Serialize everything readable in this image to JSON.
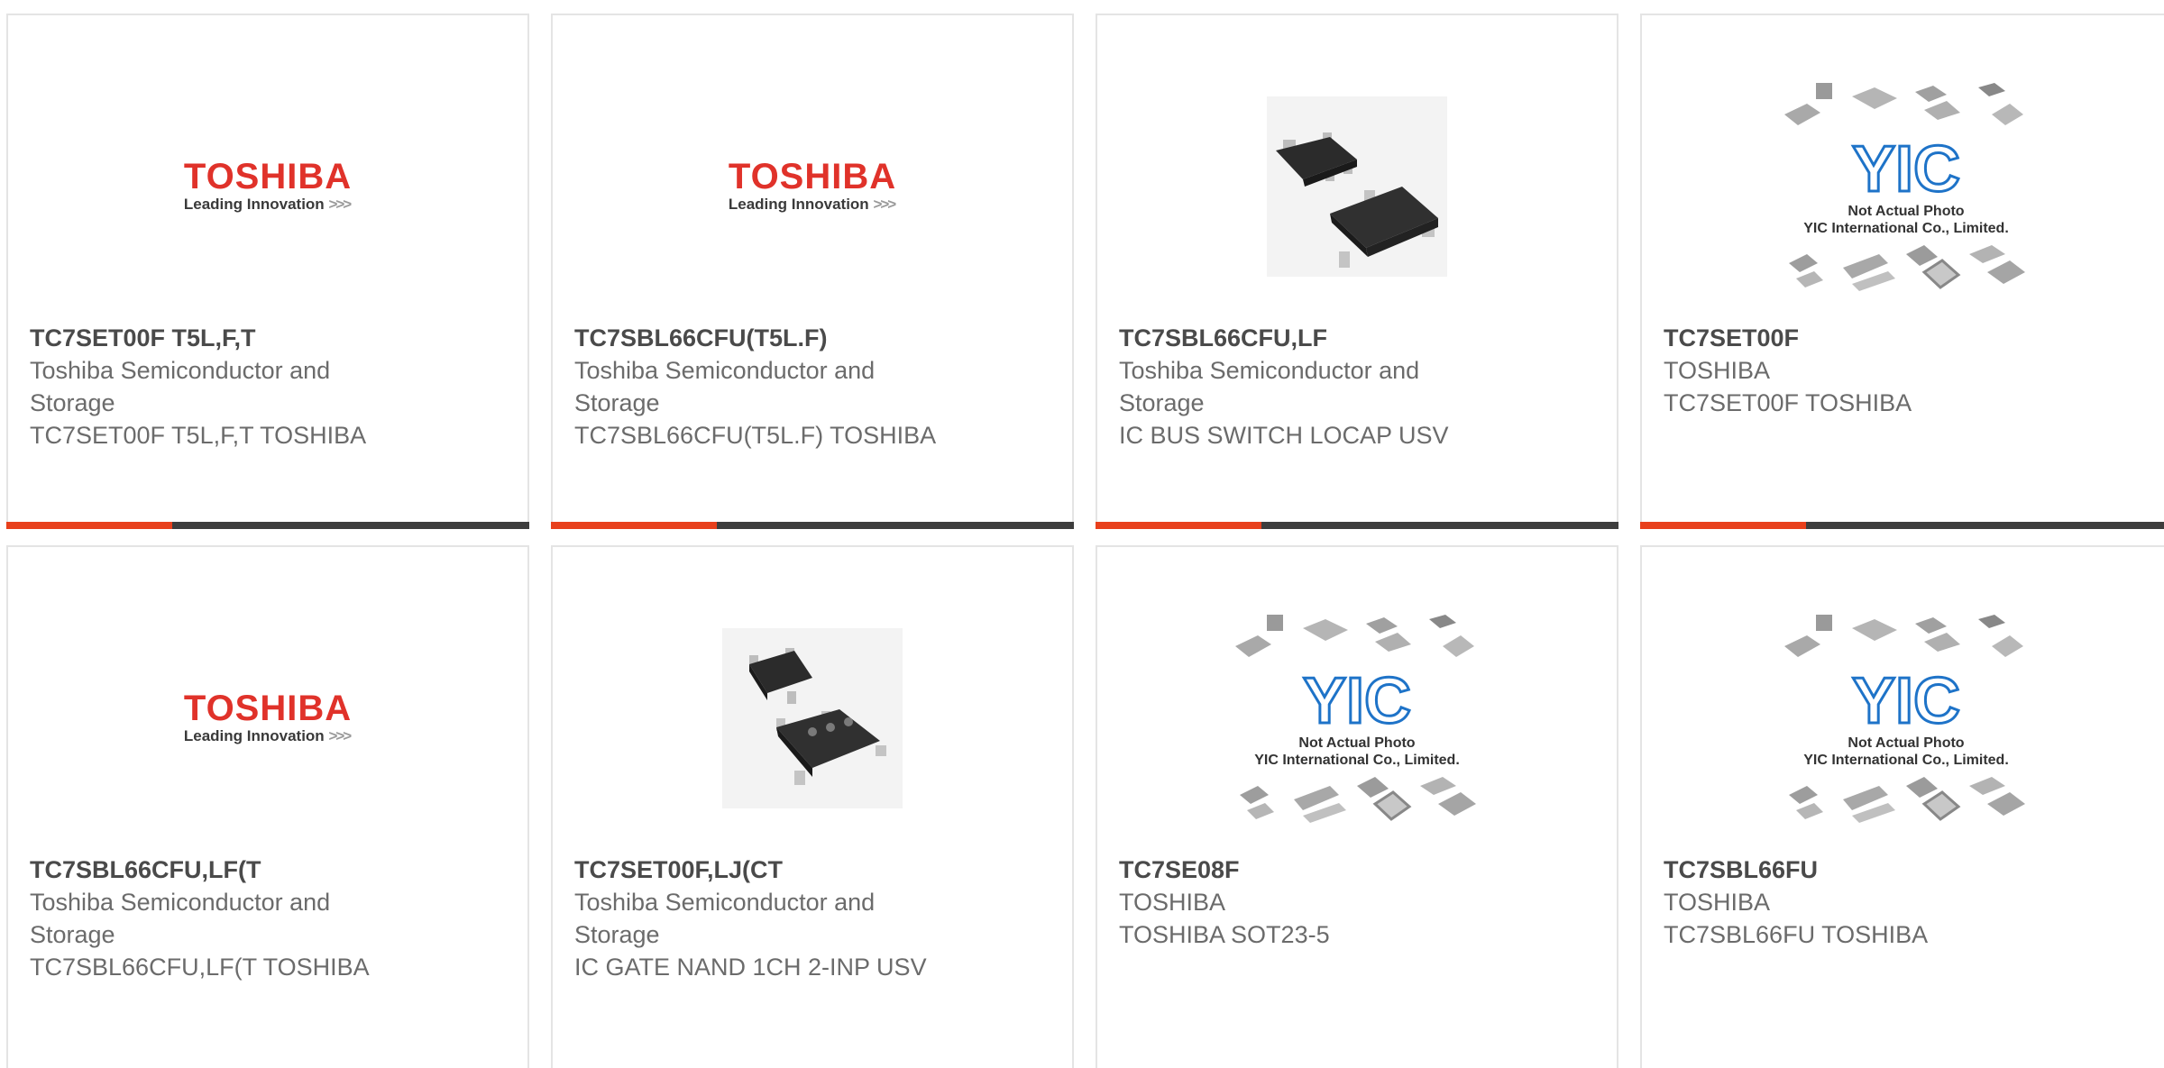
{
  "products": [
    {
      "part": "TC7SET00F T5L,F,T",
      "mfr_line1": "Toshiba Semiconductor and",
      "mfr_line2": "Storage",
      "desc": "TC7SET00F T5L,F,T TOSHIBA",
      "image": "toshiba-logo"
    },
    {
      "part": "TC7SBL66CFU(T5L.F)",
      "mfr_line1": "Toshiba Semiconductor and",
      "mfr_line2": "Storage",
      "desc": "TC7SBL66CFU(T5L.F) TOSHIBA",
      "image": "toshiba-logo"
    },
    {
      "part": "TC7SBL66CFU,LF",
      "mfr_line1": "Toshiba Semiconductor and",
      "mfr_line2": "Storage",
      "desc": "IC BUS SWITCH LOCAP USV",
      "image": "chip-photo"
    },
    {
      "part": "TC7SET00F",
      "mfr_line1": "TOSHIBA",
      "mfr_line2": "",
      "desc": "TC7SET00F TOSHIBA",
      "image": "not-actual-photo"
    },
    {
      "part": "TC7SBL66CFU,LF(T",
      "mfr_line1": "Toshiba Semiconductor and",
      "mfr_line2": "Storage",
      "desc": "TC7SBL66CFU,LF(T TOSHIBA",
      "image": "toshiba-logo"
    },
    {
      "part": "TC7SET00F,LJ(CT",
      "mfr_line1": "Toshiba Semiconductor and",
      "mfr_line2": "Storage",
      "desc": "IC GATE NAND 1CH 2-INP USV",
      "image": "chip-photo"
    },
    {
      "part": "TC7SE08F",
      "mfr_line1": "TOSHIBA",
      "mfr_line2": "",
      "desc": "TOSHIBA SOT23-5",
      "image": "not-actual-photo"
    },
    {
      "part": "TC7SBL66FU",
      "mfr_line1": "TOSHIBA",
      "mfr_line2": "",
      "desc": "TC7SBL66FU TOSHIBA",
      "image": "not-actual-photo"
    }
  ],
  "logo": {
    "brand": "TOSHIBA",
    "tagline": "Leading Innovation",
    "chevrons": ">>>"
  },
  "placeholder": {
    "line1": "Not Actual Photo",
    "line2": "YIC International Co., Limited.",
    "brand": "YIC"
  },
  "colors": {
    "accent": "#e8401c",
    "bar": "#3d3d3d",
    "toshiba_red": "#e0322a",
    "yic_blue": "#1e73c8"
  }
}
